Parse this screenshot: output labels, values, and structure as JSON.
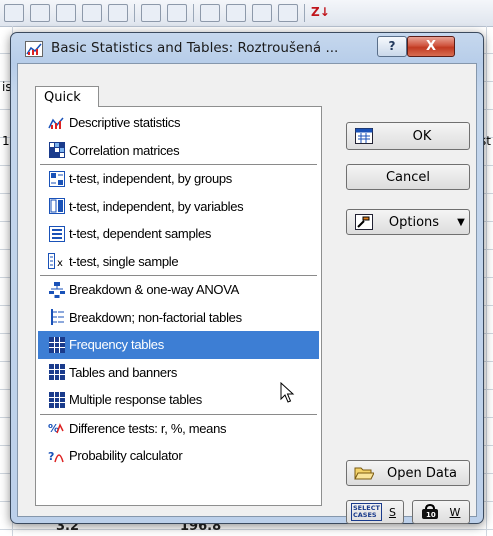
{
  "dialog": {
    "title": "Basic Statistics and Tables: Roztroušená ...",
    "help_label": "?",
    "close_label": "X"
  },
  "tabs": [
    {
      "label": "Quick"
    }
  ],
  "procedures": {
    "group1": [
      {
        "label": "Descriptive statistics",
        "icon": "descriptive-stats-icon"
      },
      {
        "label": "Correlation matrices",
        "icon": "correlation-matrix-icon"
      }
    ],
    "group2": [
      {
        "label": "t-test, independent, by groups",
        "icon": "ttest-groups-icon"
      },
      {
        "label": "t-test, independent, by variables",
        "icon": "ttest-variables-icon"
      },
      {
        "label": "t-test, dependent samples",
        "icon": "ttest-dependent-icon"
      },
      {
        "label": "t-test, single sample",
        "icon": "ttest-single-icon"
      }
    ],
    "group3": [
      {
        "label": "Breakdown & one-way ANOVA",
        "icon": "breakdown-anova-icon"
      },
      {
        "label": "Breakdown; non-factorial tables",
        "icon": "breakdown-nonfactorial-icon"
      },
      {
        "label": "Frequency tables",
        "icon": "frequency-tables-icon",
        "selected": true
      },
      {
        "label": "Tables and banners",
        "icon": "tables-banners-icon"
      },
      {
        "label": "Multiple response tables",
        "icon": "multiple-response-icon"
      }
    ],
    "group4": [
      {
        "label": "Difference tests: r, %, means",
        "icon": "difference-tests-icon"
      },
      {
        "label": "Probability calculator",
        "icon": "probability-calculator-icon"
      }
    ]
  },
  "buttons": {
    "ok": "OK",
    "cancel": "Cancel",
    "options": "Options",
    "open_data": "Open Data",
    "select_cases_line1": "SELECT",
    "select_cases_line2": "CASES",
    "select_cases_key": "S",
    "weight_key": "W"
  },
  "background": {
    "left_cells": [
      "is",
      "1"
    ],
    "right_cells": [
      "st"
    ],
    "bottom_values": [
      "3.2",
      "196.8"
    ],
    "toolbar_z": "Z↓"
  },
  "colors": {
    "selection": "#3d7ed4",
    "close_button": "#c8452d",
    "title_bar": "#bcd0ea"
  }
}
